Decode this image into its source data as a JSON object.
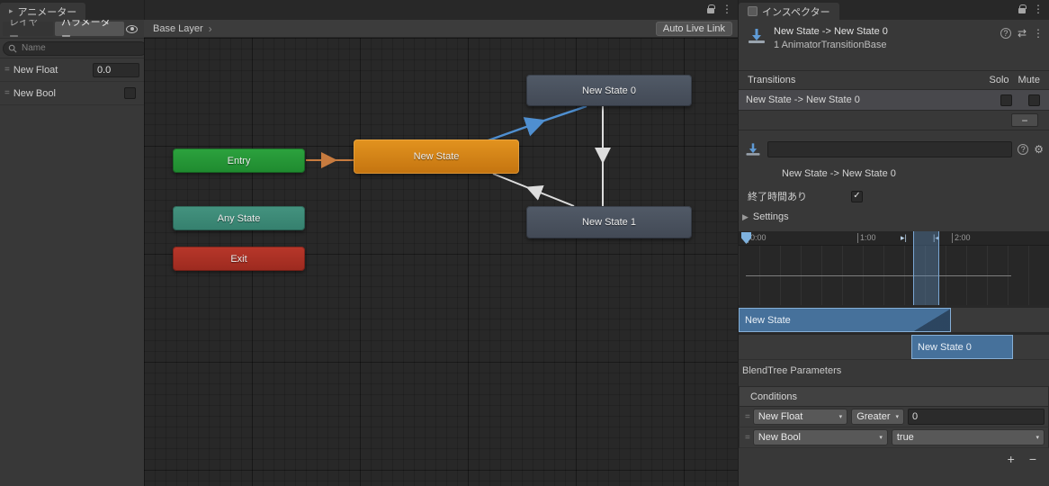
{
  "colors": {
    "accent_blue": "#4F8FD0",
    "transition_default": "#DDDDDD",
    "transition_selected": "#4F8FD0",
    "transition_entry": "#C77B3F",
    "node_gray": "#4A535F",
    "node_orange": "#D9831A",
    "node_green": "#2AA03C",
    "node_teal": "#3F8D7C",
    "node_red": "#AE3226",
    "timeline_bar_blue": "#46719B"
  },
  "icons": {
    "menu": "⋮",
    "breadcrumb_chevron": "›",
    "dropdown_caret": "▾",
    "plus": "+",
    "minus": "−",
    "check": "✓",
    "foldout_collapsed": "▶",
    "help": "?",
    "presets": "⇄",
    "gear": "⚙",
    "marker_in": "▸|",
    "marker_out": "|◂",
    "equals_handle": "=",
    "animator_tab": "▸"
  },
  "animator_panel": {
    "tab_title": "アニメーター",
    "layers_tab": "レイヤー",
    "parameters_tab": "パラメーター",
    "search_placeholder": "Name",
    "parameters": [
      {
        "name": "New Float",
        "value": "0.0"
      },
      {
        "name": "New Bool"
      }
    ]
  },
  "graph": {
    "breadcrumb": "Base Layer",
    "auto_live_link_label": "Auto Live Link",
    "nodes": {
      "new_state_0": "New State 0",
      "entry": "Entry",
      "new_state": "New State",
      "any_state": "Any State",
      "new_state_1": "New State 1",
      "exit": "Exit"
    }
  },
  "inspector": {
    "tab_title": "インスペクター",
    "header": {
      "title": "New State -> New State 0",
      "subtitle": "1 AnimatorTransitionBase"
    },
    "transitions": {
      "label": "Transitions",
      "solo": "Solo",
      "mute": "Mute",
      "rows": [
        {
          "label": "New State -> New State 0"
        }
      ]
    },
    "name_field_value": "",
    "transition_label": "New State -> New State 0",
    "has_exit_time_label": "終了時間あり",
    "settings_label": "Settings",
    "timeline": {
      "ticks": [
        "0:00",
        "1:00",
        "2:00"
      ],
      "tracks": [
        "New State",
        "New State 0"
      ]
    },
    "blendtree_label": "BlendTree Parameters",
    "conditions": {
      "label": "Conditions",
      "rows": [
        {
          "parameter": "New Float",
          "operator": "Greater",
          "value": "0"
        },
        {
          "parameter": "New Bool",
          "operator": "true"
        }
      ]
    }
  }
}
